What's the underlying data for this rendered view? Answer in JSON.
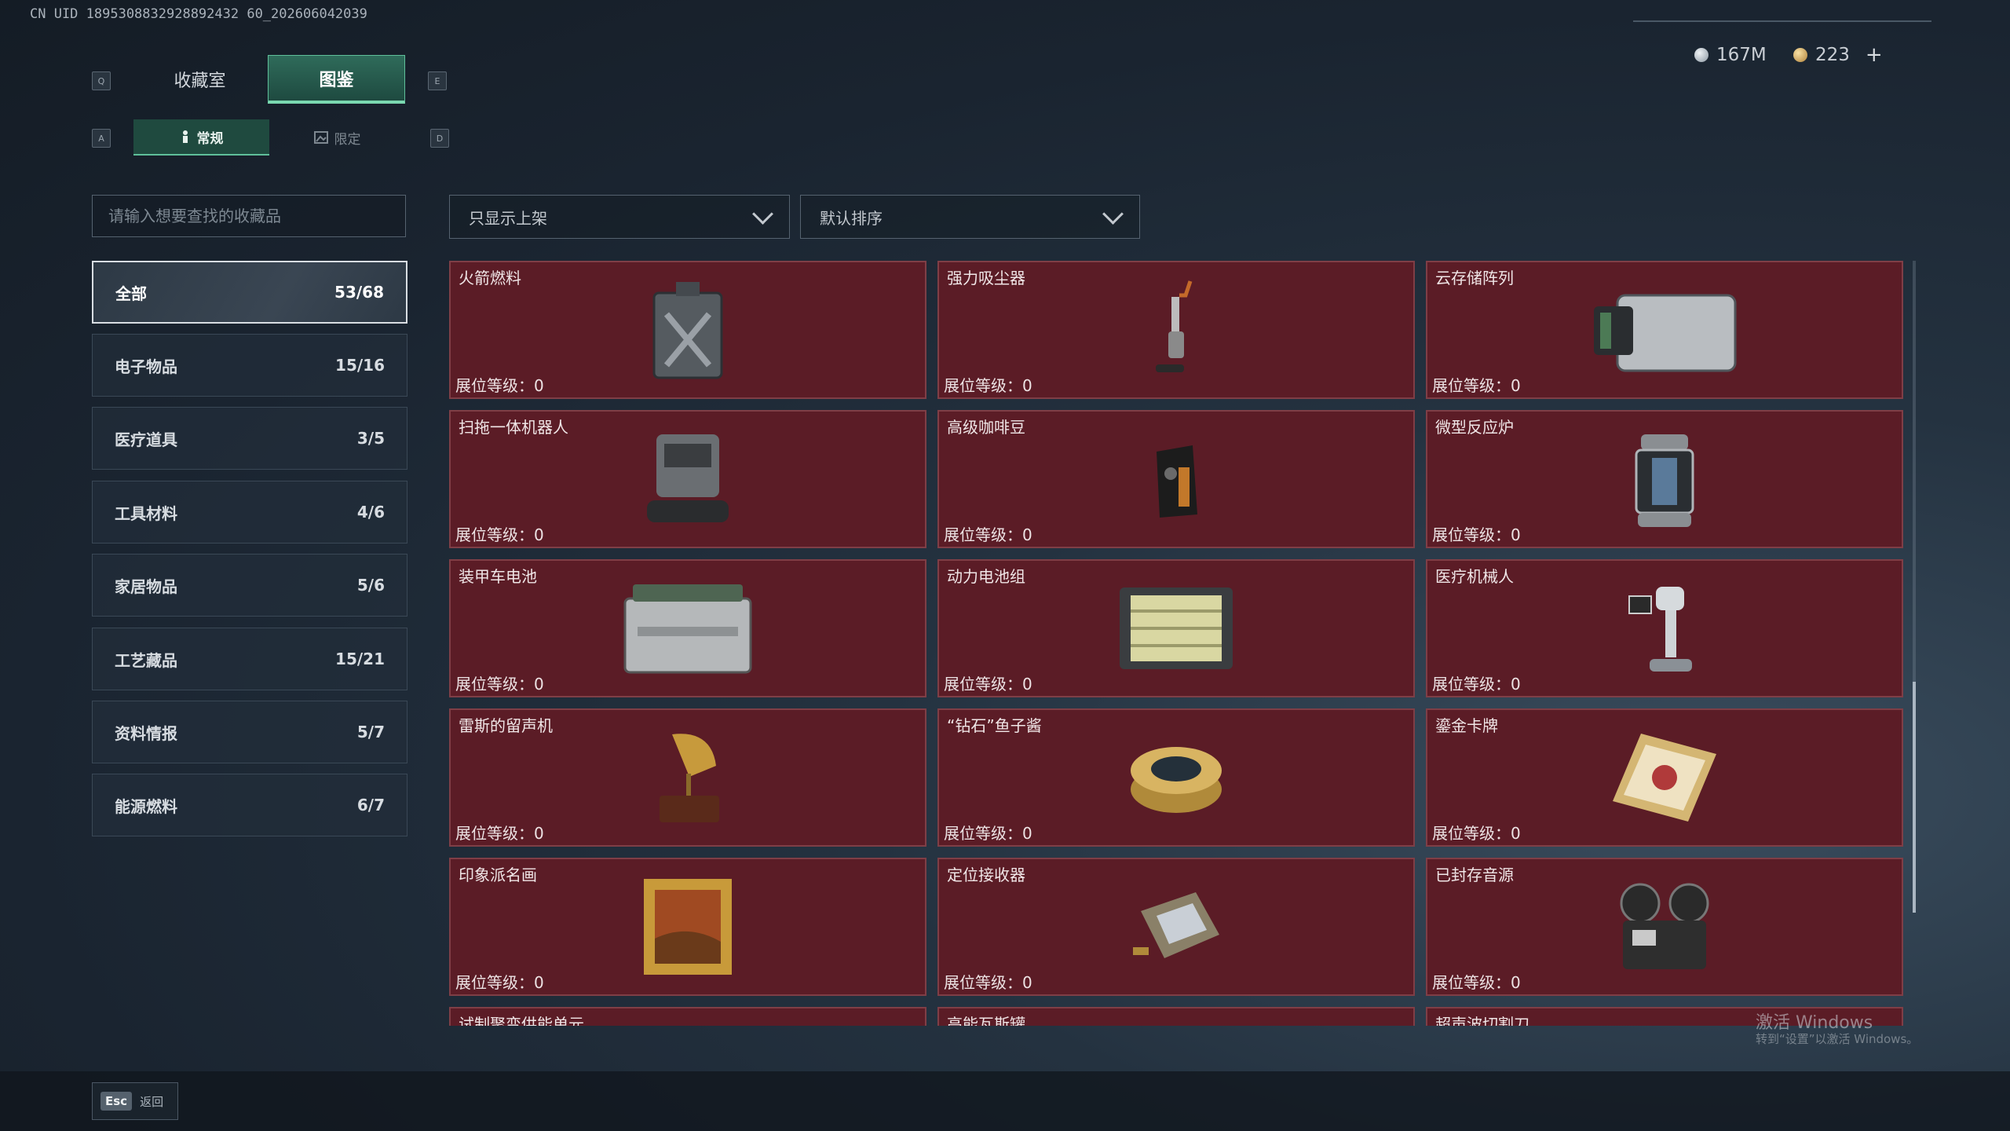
{
  "header": {
    "uid": "CN UID 1895308832928892432 60_202606042039",
    "currency": [
      {
        "icon": "silver-coin-icon",
        "value": "167M"
      },
      {
        "icon": "gold-coin-icon",
        "value": "223"
      }
    ],
    "plus_label": "+"
  },
  "keys": {
    "q": "Q",
    "e": "E",
    "a": "A",
    "d": "D"
  },
  "tabs": [
    {
      "label": "收藏室",
      "active": false
    },
    {
      "label": "图鉴",
      "active": true
    }
  ],
  "subtabs": [
    {
      "label": "常规",
      "icon": "figure-icon",
      "active": true
    },
    {
      "label": "限定",
      "icon": "image-icon",
      "active": false
    }
  ],
  "search": {
    "placeholder": "请输入想要查找的收藏品"
  },
  "filters": {
    "shelf_filter": "只显示上架",
    "sort": "默认排序"
  },
  "categories": [
    {
      "label": "全部",
      "count": "53/68",
      "active": true
    },
    {
      "label": "电子物品",
      "count": "15/16"
    },
    {
      "label": "医疗道具",
      "count": "3/5"
    },
    {
      "label": "工具材料",
      "count": "4/6"
    },
    {
      "label": "家居物品",
      "count": "5/6"
    },
    {
      "label": "工艺藏品",
      "count": "15/21"
    },
    {
      "label": "资料情报",
      "count": "5/7"
    },
    {
      "label": "能源燃料",
      "count": "6/7"
    }
  ],
  "items": [
    {
      "name": "火箭燃料",
      "level": "展位等级：0",
      "icon": "fuel-can-icon"
    },
    {
      "name": "强力吸尘器",
      "level": "展位等级：0",
      "icon": "vacuum-icon"
    },
    {
      "name": "云存储阵列",
      "level": "展位等级：0",
      "icon": "server-icon"
    },
    {
      "name": "扫拖一体机器人",
      "level": "展位等级：0",
      "icon": "robot-mop-icon"
    },
    {
      "name": "高级咖啡豆",
      "level": "展位等级：0",
      "icon": "coffee-bag-icon"
    },
    {
      "name": "微型反应炉",
      "level": "展位等级：0",
      "icon": "reactor-icon"
    },
    {
      "name": "装甲车电池",
      "level": "展位等级：0",
      "icon": "battery-icon"
    },
    {
      "name": "动力电池组",
      "level": "展位等级：0",
      "icon": "battery-pack-icon"
    },
    {
      "name": "医疗机械人",
      "level": "展位等级：0",
      "icon": "medical-robot-icon"
    },
    {
      "name": "雷斯的留声机",
      "level": "展位等级：0",
      "icon": "gramophone-icon"
    },
    {
      "name": "“钻石”鱼子酱",
      "level": "展位等级：0",
      "icon": "caviar-tin-icon"
    },
    {
      "name": "鎏金卡牌",
      "level": "展位等级：0",
      "icon": "gold-card-icon"
    },
    {
      "name": "印象派名画",
      "level": "展位等级：0",
      "icon": "painting-icon"
    },
    {
      "name": "定位接收器",
      "level": "展位等级：0",
      "icon": "receiver-icon"
    },
    {
      "name": "已封存音源",
      "level": "展位等级：0",
      "icon": "reel-recorder-icon"
    },
    {
      "name": "试制聚变供能单元",
      "level": "",
      "icon": ""
    },
    {
      "name": "高能瓦斯罐",
      "level": "",
      "icon": ""
    },
    {
      "name": "超声波切割刀",
      "level": "",
      "icon": ""
    }
  ],
  "footer": {
    "esc_key": "Esc",
    "esc_label": "返回"
  },
  "watermark": {
    "line1": "激活 Windows",
    "line2": "转到“设置”以激活 Windows。"
  },
  "colors": {
    "card_bg": "#5b1c26",
    "accent": "#5fbf9a"
  }
}
